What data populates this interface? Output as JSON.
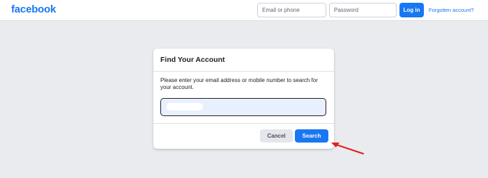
{
  "header": {
    "logo": "facebook",
    "email_placeholder": "Email or phone",
    "password_placeholder": "Password",
    "login_label": "Log in",
    "forgot_label": "Forgotten account?"
  },
  "dialog": {
    "title": "Find Your Account",
    "description": "Please enter your email address or mobile number to search for your account.",
    "input_value": "",
    "cancel_label": "Cancel",
    "search_label": "Search"
  },
  "annotation": {
    "arrow_color": "#e02020",
    "points_to": "search-button"
  },
  "colors": {
    "brand": "#1877f2",
    "page_bg": "#e9ebee",
    "input_fill": "#e8f0fe"
  }
}
